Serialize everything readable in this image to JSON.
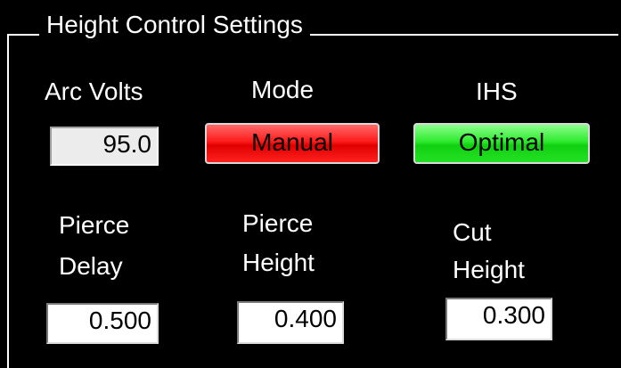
{
  "group": {
    "title": "Height Control Settings"
  },
  "arc_volts": {
    "label": "Arc Volts",
    "value": "95.0"
  },
  "mode": {
    "label": "Mode",
    "button_label": "Manual",
    "button_color": "#ff1a1a"
  },
  "ihs": {
    "label": "IHS",
    "button_label": "Optimal",
    "button_color": "#22dd22"
  },
  "pierce_delay": {
    "label_line1": "Pierce",
    "label_line2": "Delay",
    "value": "0.500"
  },
  "pierce_height": {
    "label_line1": "Pierce",
    "label_line2": "Height",
    "value": "0.400"
  },
  "cut_height": {
    "label_line1": "Cut",
    "label_line2": "Height",
    "value": "0.300"
  }
}
